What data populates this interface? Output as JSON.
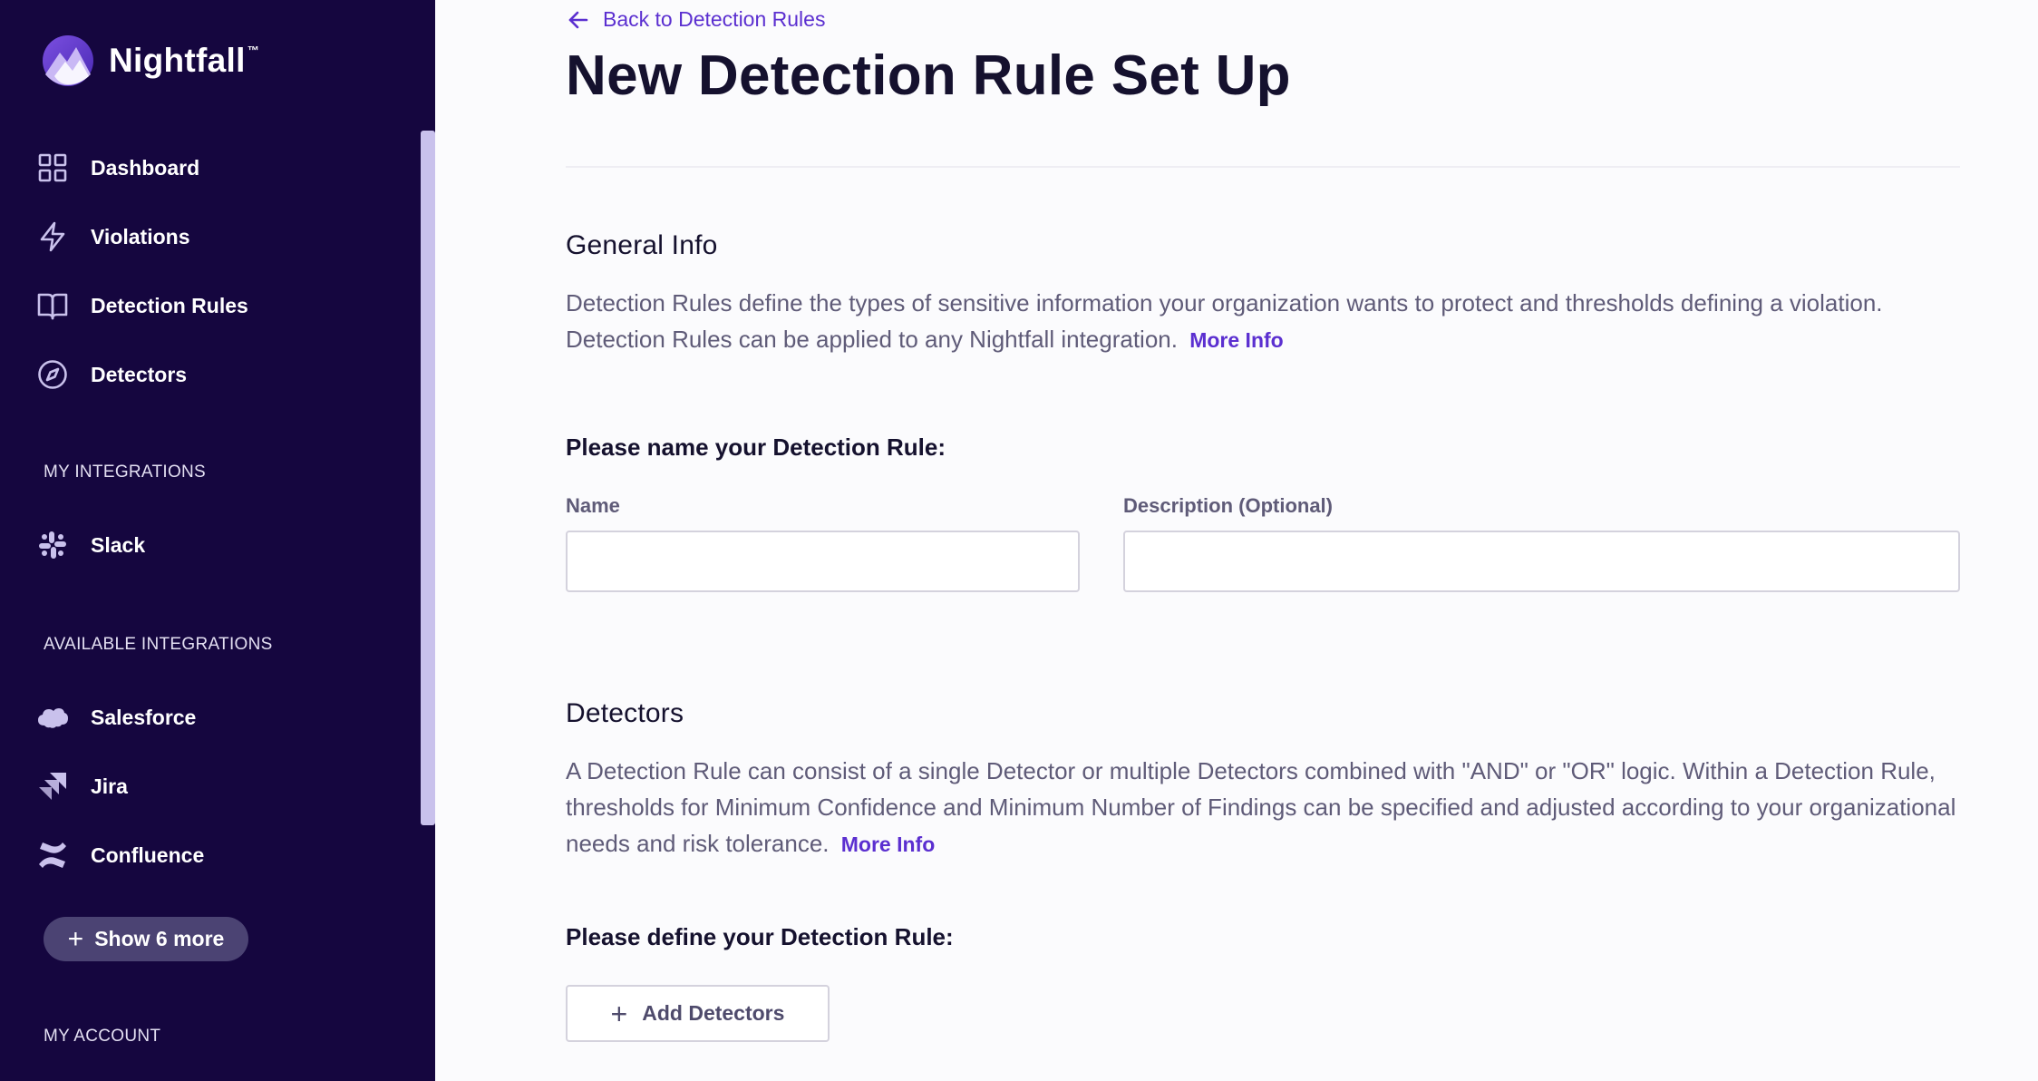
{
  "brand": {
    "name": "Nightfall",
    "tm": "™"
  },
  "sidebar": {
    "nav": [
      {
        "label": "Dashboard",
        "icon": "dashboard-icon"
      },
      {
        "label": "Violations",
        "icon": "lightning-icon"
      },
      {
        "label": "Detection Rules",
        "icon": "book-icon"
      },
      {
        "label": "Detectors",
        "icon": "compass-icon"
      }
    ],
    "my_integrations_label": "MY INTEGRATIONS",
    "my_integrations": [
      {
        "label": "Slack",
        "icon": "slack-icon"
      }
    ],
    "available_integrations_label": "AVAILABLE INTEGRATIONS",
    "available_integrations": [
      {
        "label": "Salesforce",
        "icon": "salesforce-icon"
      },
      {
        "label": "Jira",
        "icon": "jira-icon"
      },
      {
        "label": "Confluence",
        "icon": "confluence-icon"
      }
    ],
    "show_more_label": "Show 6 more",
    "my_account_label": "MY ACCOUNT"
  },
  "main": {
    "back_label": "Back to Detection Rules",
    "title": "New Detection Rule Set Up",
    "general": {
      "heading": "General Info",
      "text": "Detection Rules define the types of sensitive information your organization wants to protect and thresholds defining a violation. Detection Rules can be applied to any Nightfall integration.",
      "more_info": "More Info",
      "name_prompt": "Please name your Detection Rule:",
      "name_label": "Name",
      "name_value": "",
      "description_label": "Description (Optional)",
      "description_value": ""
    },
    "detectors": {
      "heading": "Detectors",
      "text": "A Detection Rule can consist of a single Detector or multiple Detectors combined with \"AND\" or \"OR\" logic. Within a Detection Rule, thresholds for Minimum Confidence and Minimum Number of Findings can be specified and adjusted according to your organizational needs and risk tolerance.",
      "more_info": "More Info",
      "define_prompt": "Please define your Detection Rule:",
      "add_button": "Add Detectors"
    }
  },
  "colors": {
    "sidebar_bg": "#15063f",
    "accent": "#5b2fd0",
    "scrollbar": "#c9c1ec",
    "show_more_bg": "#4b4373"
  }
}
